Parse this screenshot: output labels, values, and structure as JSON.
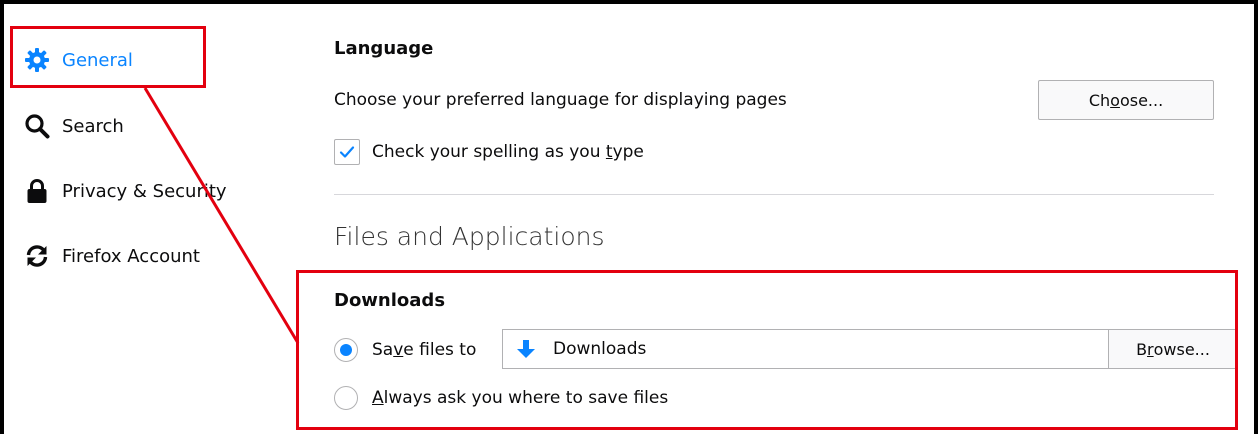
{
  "sidebar": {
    "items": [
      {
        "label": "General",
        "icon": "gear-icon",
        "selected": true
      },
      {
        "label": "Search",
        "icon": "search-icon",
        "selected": false
      },
      {
        "label": "Privacy & Security",
        "icon": "lock-icon",
        "selected": false
      },
      {
        "label": "Firefox Account",
        "icon": "sync-icon",
        "selected": false
      }
    ]
  },
  "language": {
    "heading": "Language",
    "description": "Choose your preferred language for displaying pages",
    "choose_button": {
      "before": "Ch",
      "accesskey": "o",
      "after": "ose..."
    },
    "spellcheck": {
      "before": "Check your spelling as you ",
      "accesskey": "t",
      "after": "ype",
      "checked": true
    }
  },
  "files": {
    "heading": "Files and Applications",
    "downloads": {
      "heading": "Downloads",
      "save_option": {
        "before": "Sa",
        "accesskey": "v",
        "after": "e files to",
        "selected": true
      },
      "folder": "Downloads",
      "folder_icon": "download-arrow-icon",
      "browse_button": {
        "before": "B",
        "accesskey": "r",
        "after": "owse..."
      },
      "ask_option": {
        "before": "",
        "accesskey": "A",
        "after": "lways ask you where to save files",
        "selected": false
      }
    }
  },
  "colors": {
    "accent": "#0a84ff",
    "annotation": "#e3000f"
  }
}
